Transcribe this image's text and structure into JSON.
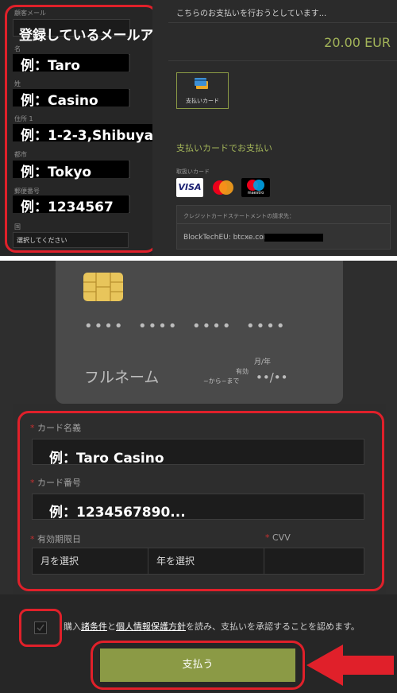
{
  "top": {
    "form": {
      "email_label": "顧客メール",
      "email_note": "登録しているメールアドレス",
      "first_name_label": "名",
      "first_name_example": "例：Taro",
      "last_name_label": "姓",
      "last_name_example": "例：Casino",
      "address_label": "住所 1",
      "address_example": "例：1-2-3,Shibuya",
      "city_label": "都市",
      "city_example": "例：Tokyo",
      "zip_label": "郵便番号",
      "zip_example": "例：1234567",
      "country_label": "国",
      "country_placeholder": "選択してください"
    },
    "payment": {
      "notice": "こちらのお支払いを行おうとしています...",
      "amount": "20.00 EUR",
      "method_label": "支払いカード",
      "pay_by_card": "支払いカードでお支払い",
      "accepted_cards": "取扱いカード",
      "visa": "VISA",
      "maestro": "maestro",
      "statement_label": "クレジットカードステートメントの請求先：",
      "statement_value": "BlockTechEU: btcxe.com"
    }
  },
  "card_preview": {
    "number_mask": [
      "••••",
      "••••",
      "••••",
      "••••"
    ],
    "name": "フルネーム",
    "expiry_label_top": "月/年",
    "expiry_from": "~から~まで",
    "valid_label": "有効",
    "expiry_value": "••/••"
  },
  "card_form": {
    "holder_label": "カード名義",
    "holder_example": "例：Taro Casino",
    "number_label": "カード番号",
    "number_example": "例：1234567890...",
    "expiry_label": "有効期限日",
    "cvv_label": "CVV",
    "month_placeholder": "月を選択",
    "year_placeholder": "年を選択"
  },
  "agreement": {
    "prefix": "購入",
    "terms_link": "諸条件",
    "and": "と",
    "privacy_link": "個人情報保護方針",
    "suffix": "を読み、支払いを承認することを認めます。"
  },
  "pay_button": "支払う",
  "colors": {
    "accent": "#8b9a45",
    "highlight": "#e0202a"
  }
}
